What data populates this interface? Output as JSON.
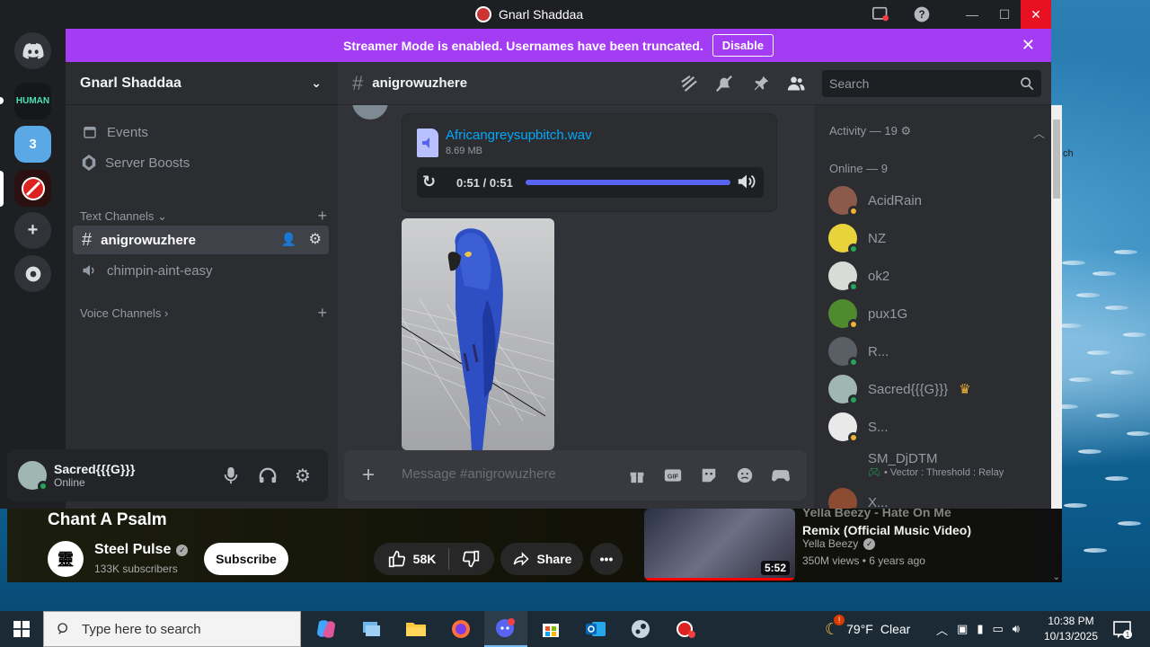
{
  "window": {
    "title": "Gnarl Shaddaa"
  },
  "banner": {
    "text": "Streamer Mode is enabled. Usernames have been truncated.",
    "button": "Disable"
  },
  "server": {
    "name": "Gnarl Shaddaa",
    "rail": [
      {
        "name": "Direct Messages"
      },
      {
        "name": "HUMAN"
      },
      {
        "name": "3 MAX"
      },
      {
        "name": "Gnarl Shaddaa"
      }
    ]
  },
  "sidebar": {
    "events": "Events",
    "boosts": "Server Boosts",
    "text_category": "Text Channels",
    "voice_category": "Voice Channels",
    "channels": [
      {
        "name": "anigrowuzhere",
        "type": "text",
        "active": true
      },
      {
        "name": "chimpin-aint-easy",
        "type": "voice",
        "active": false
      }
    ]
  },
  "user": {
    "name": "Sacred{{{G}}}",
    "status": "Online"
  },
  "chat": {
    "channel": "anigrowuzhere",
    "search_placeholder": "Search",
    "attachment": {
      "filename": "Africangreysupbitch.wav",
      "size": "8.69 MB",
      "time": "0:51 / 0:51",
      "progress": 1.0
    },
    "composer_placeholder": "Message #anigrowuzhere"
  },
  "members": {
    "activity": "Activity — 19",
    "online": "Online — 9",
    "list": [
      {
        "name": "AcidRain",
        "status": "idle",
        "color": "#8b5a4a"
      },
      {
        "name": "NZ",
        "status": "online",
        "color": "#e8d33a"
      },
      {
        "name": "ok2",
        "status": "online",
        "color": "#d8dcd6"
      },
      {
        "name": "pux1G",
        "status": "idle",
        "color": "#4f8a2f"
      },
      {
        "name": "R...",
        "status": "online",
        "color": "#5a5f66"
      },
      {
        "name": "Sacred{{{G}}}",
        "status": "online",
        "color": "#9fb7b0",
        "crown": true
      },
      {
        "name": "S...",
        "status": "idle",
        "color": "#e9e9ea"
      },
      {
        "name": "SM_DjDTM",
        "status": "none",
        "color": "#2b2d31",
        "activity": "• Vector : Threshold : Relay"
      },
      {
        "name": "X...",
        "status": "idle",
        "color": "#8c4c32"
      }
    ]
  },
  "youtube": {
    "title": "Chant A Psalm",
    "channel": "Steel Pulse",
    "subscribers": "133K subscribers",
    "subscribe": "Subscribe",
    "likes": "58K",
    "share": "Share",
    "related": {
      "title_top": "Yella Beezy - Hate On Me",
      "title": "Remix (Official Music Video)",
      "channel": "Yella Beezy",
      "meta": "350M views • 6 years ago",
      "duration": "5:52"
    }
  },
  "taskbar": {
    "search_placeholder": "Type here to search",
    "weather_temp": "79°F",
    "weather_text": "Clear",
    "time": "10:38 PM",
    "date": "10/13/2025",
    "notifications": "1"
  }
}
